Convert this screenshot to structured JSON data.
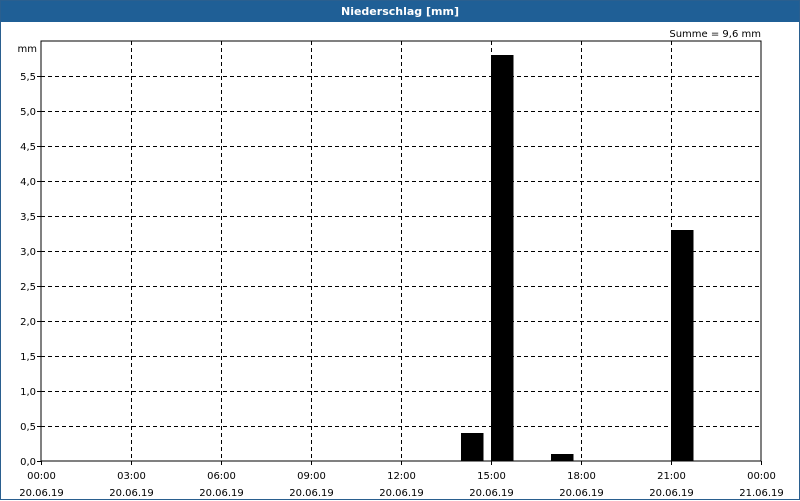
{
  "window": {
    "title": "Niederschlag [mm]"
  },
  "summary": "Summe = 9,6 mm",
  "chart_data": {
    "type": "bar",
    "title": "Niederschlag [mm]",
    "ylabel": "mm",
    "ylim": [
      0,
      6.0
    ],
    "yticks": [
      "0,0",
      "0,5",
      "1,0",
      "1,5",
      "2,0",
      "2,5",
      "3,0",
      "3,5",
      "4,0",
      "4,5",
      "5,0",
      "5,5"
    ],
    "xticks": [
      {
        "time": "00:00",
        "date": "20.06.19"
      },
      {
        "time": "03:00",
        "date": "20.06.19"
      },
      {
        "time": "06:00",
        "date": "20.06.19"
      },
      {
        "time": "09:00",
        "date": "20.06.19"
      },
      {
        "time": "12:00",
        "date": "20.06.19"
      },
      {
        "time": "15:00",
        "date": "20.06.19"
      },
      {
        "time": "18:00",
        "date": "20.06.19"
      },
      {
        "time": "21:00",
        "date": "20.06.19"
      },
      {
        "time": "00:00",
        "date": "21.06.19"
      }
    ],
    "x_unit": "hour",
    "bars": [
      {
        "start_hour": 14.0,
        "end_hour": 14.75,
        "value": 0.4
      },
      {
        "start_hour": 15.0,
        "end_hour": 15.75,
        "value": 5.8
      },
      {
        "start_hour": 17.0,
        "end_hour": 17.75,
        "value": 0.1
      },
      {
        "start_hour": 21.0,
        "end_hour": 21.75,
        "value": 3.3
      }
    ],
    "grid": true,
    "colors": {
      "bars": "#000000",
      "title_bar": "#1f5f96",
      "grid": "#000000"
    }
  }
}
